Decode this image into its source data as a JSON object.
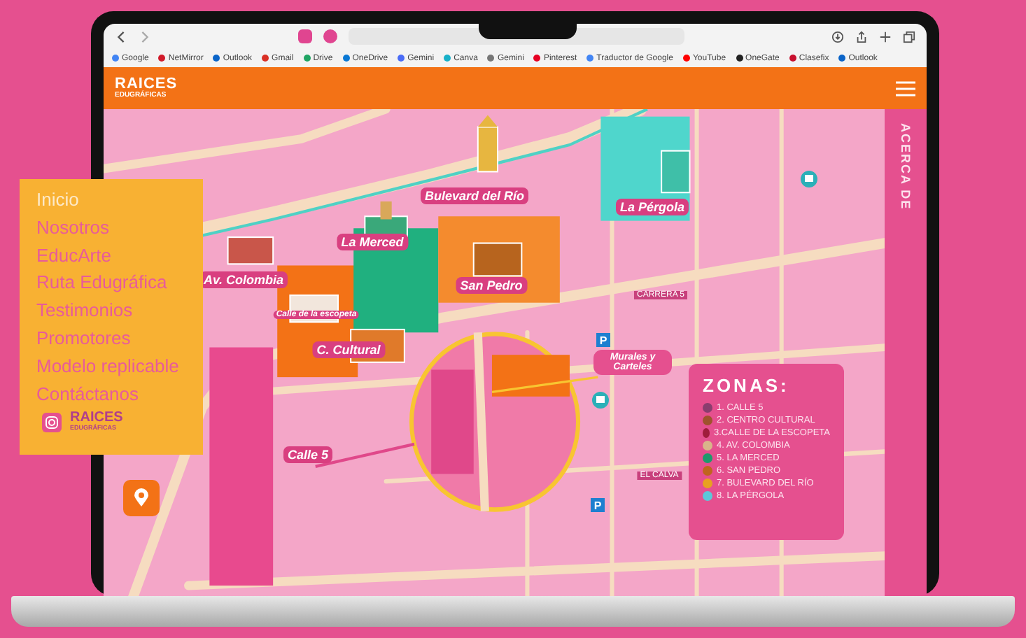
{
  "browser": {
    "bookmarks": [
      {
        "label": "Google",
        "color": "#4285f4"
      },
      {
        "label": "NetMirror",
        "color": "#d11a2a"
      },
      {
        "label": "Outlook",
        "color": "#0a64c8"
      },
      {
        "label": "Gmail",
        "color": "#d93025"
      },
      {
        "label": "Drive",
        "color": "#1fa463"
      },
      {
        "label": "OneDrive",
        "color": "#0a78d4"
      },
      {
        "label": "Gemini",
        "color": "#4a6cf7"
      },
      {
        "label": "Canva",
        "color": "#18b0c8"
      },
      {
        "label": "Gemini",
        "color": "#777777"
      },
      {
        "label": "Pinterest",
        "color": "#e60023"
      },
      {
        "label": "Traductor de Google",
        "color": "#4285f4"
      },
      {
        "label": "YouTube",
        "color": "#ff0000"
      },
      {
        "label": "OneGate",
        "color": "#222222"
      },
      {
        "label": "Clasefix",
        "color": "#c8102e"
      },
      {
        "label": "Outlook",
        "color": "#0a64c8"
      }
    ]
  },
  "site": {
    "logo_top": "RAICES",
    "logo_bottom": "EDUGRÁFICAS",
    "side_tab": "ACERCA DE"
  },
  "menu": {
    "items": [
      {
        "label": "Inicio",
        "selected": true
      },
      {
        "label": "Nosotros",
        "selected": false
      },
      {
        "label": "EducArte",
        "selected": false
      },
      {
        "label": "Ruta Edugráfica",
        "selected": false
      },
      {
        "label": "Testimonios",
        "selected": false
      },
      {
        "label": "Promotores",
        "selected": false
      },
      {
        "label": "Modelo replicable",
        "selected": false
      },
      {
        "label": "Contáctanos",
        "selected": false
      }
    ],
    "logo_top": "RAICES",
    "logo_bottom": "EDUGRÁFICAS"
  },
  "map": {
    "places": [
      {
        "label": "Bulevard del Río"
      },
      {
        "label": "La Pérgola"
      },
      {
        "label": "Av. Colombia"
      },
      {
        "label": "La Merced"
      },
      {
        "label": "San Pedro"
      },
      {
        "label": "Calle de la escopeta"
      },
      {
        "label": "C. Cultural"
      },
      {
        "label": "Calle 5"
      }
    ],
    "streets": [
      {
        "label": "CARRERA 5"
      },
      {
        "label": "EL CALVA"
      }
    ],
    "callout": "Murales y Carteles",
    "legend": {
      "title": "ZONAS:",
      "items": [
        {
          "label": "1. CALLE 5",
          "color": "#8a3d6e"
        },
        {
          "label": "2. CENTRO CULTURAL",
          "color": "#a0522d"
        },
        {
          "label": "3.CALLE DE LA ESCOPETA",
          "color": "#a01c3c"
        },
        {
          "label": "4. AV. COLOMBIA",
          "color": "#d9b48a"
        },
        {
          "label": "5. LA MERCED",
          "color": "#1d9a6c"
        },
        {
          "label": "6. SAN PEDRO",
          "color": "#c0641e"
        },
        {
          "label": "7. BULEVARD DEL RÍO",
          "color": "#e8a020"
        },
        {
          "label": "8. LA PÉRGOLA",
          "color": "#5cc7d9"
        }
      ]
    },
    "parking": [
      {
        "label": "P"
      },
      {
        "label": "P"
      }
    ]
  }
}
